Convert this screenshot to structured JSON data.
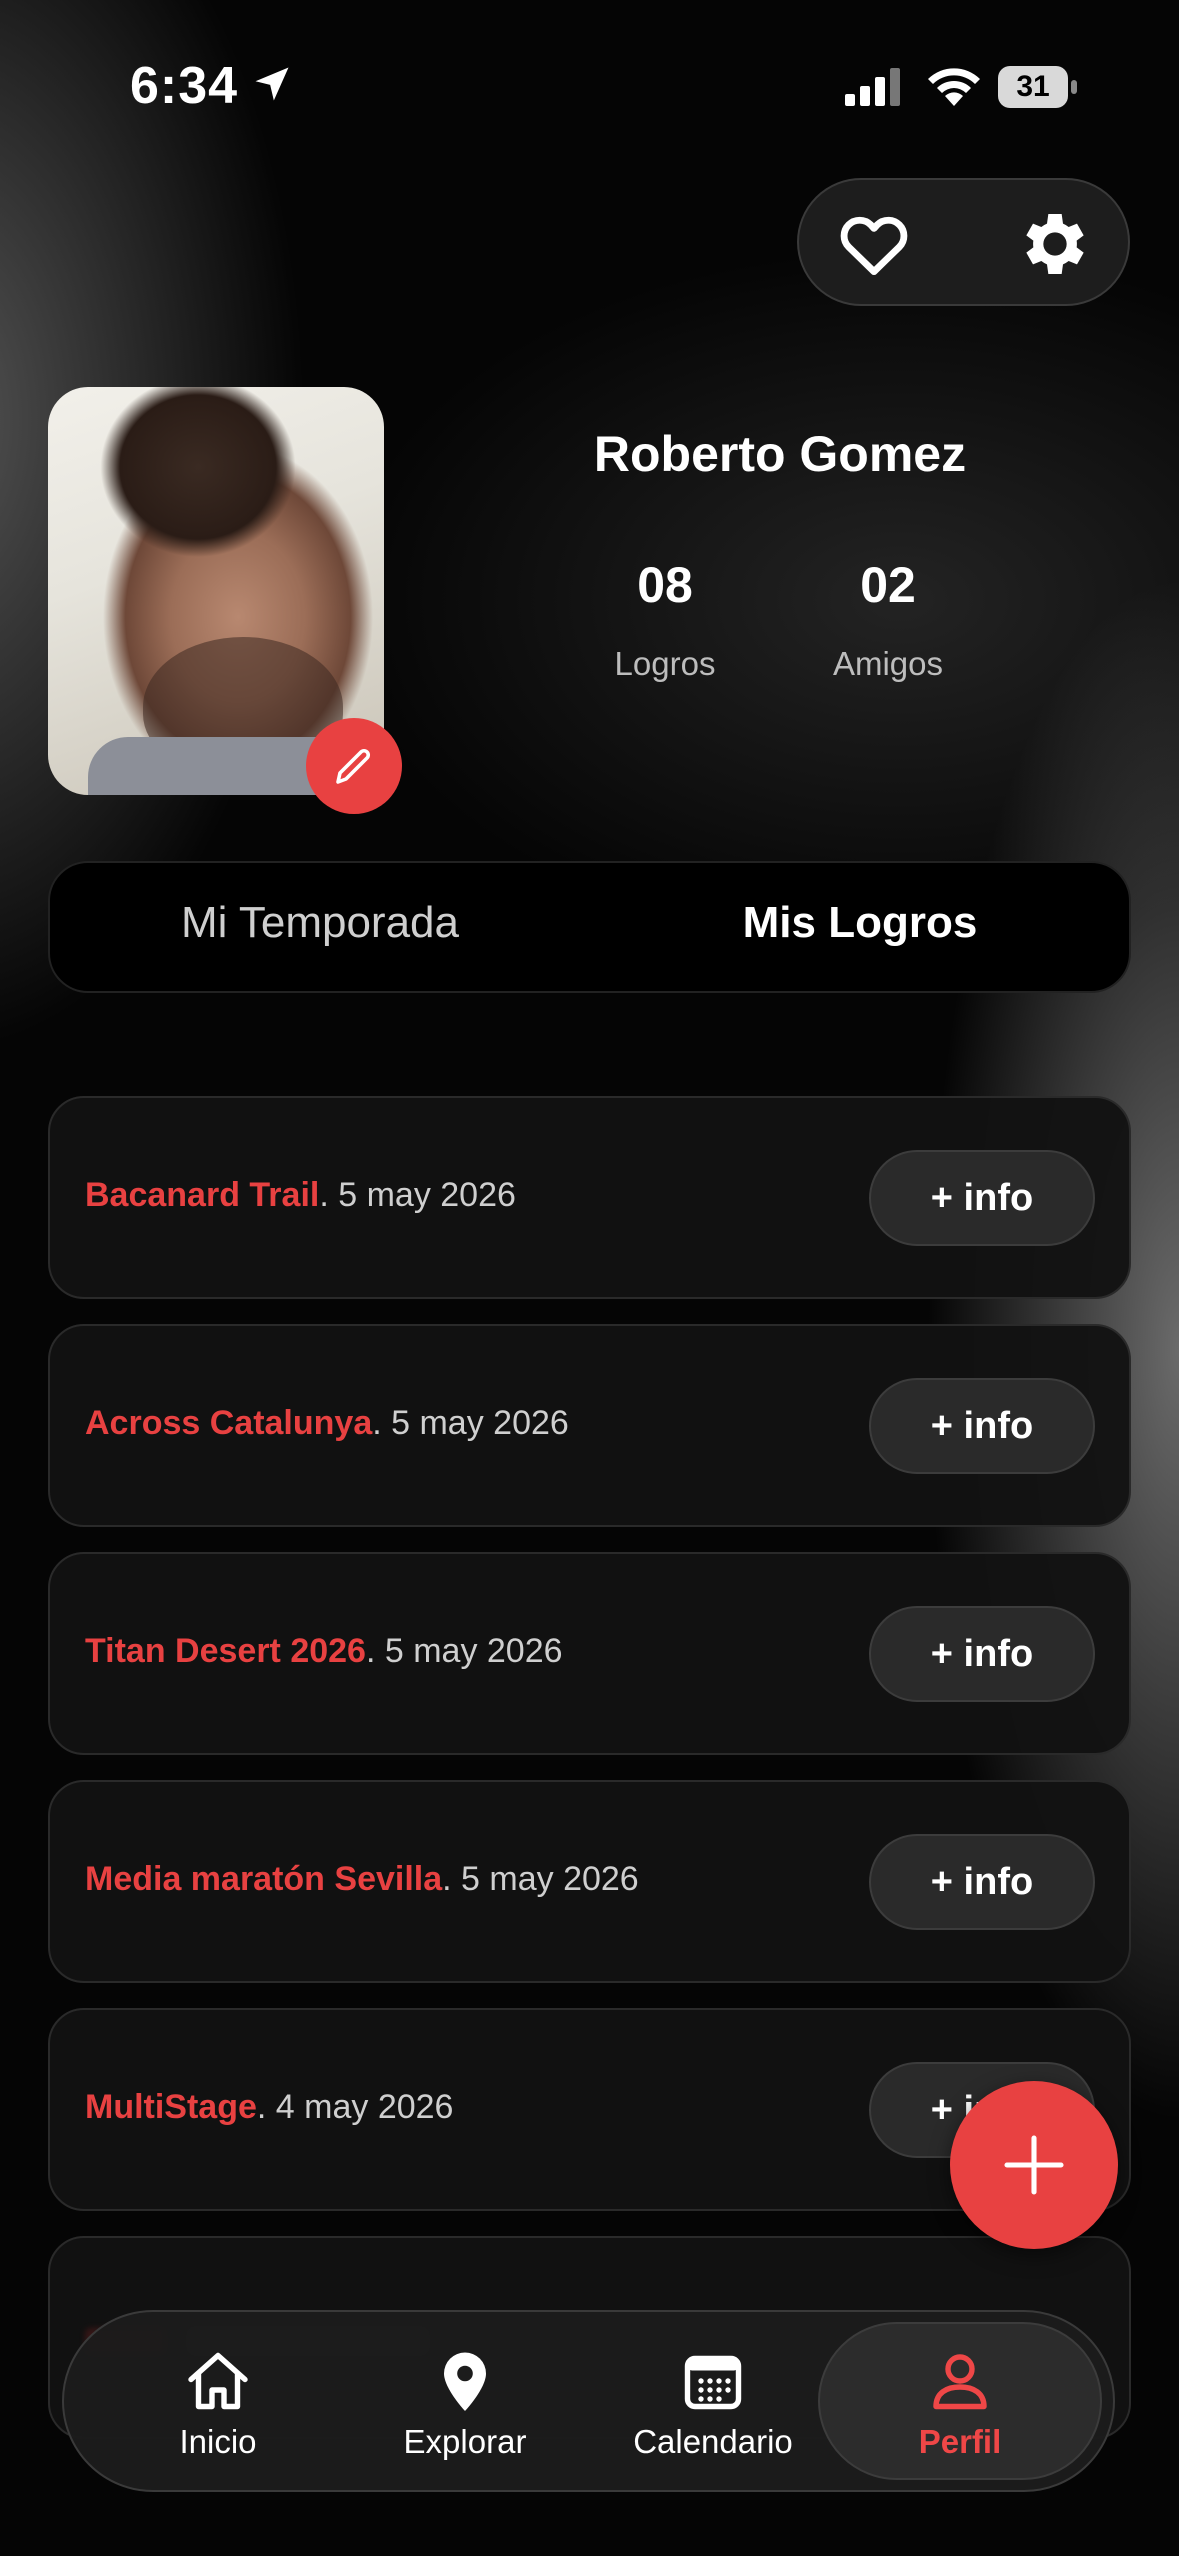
{
  "status_bar": {
    "time": "6:34",
    "battery": "31"
  },
  "profile": {
    "name": "Roberto Gomez",
    "stats": [
      {
        "value": "08",
        "label": "Logros"
      },
      {
        "value": "02",
        "label": "Amigos"
      }
    ]
  },
  "tabs": {
    "season": "Mi Temporada",
    "achievements": "Mis Logros",
    "selected": "Mis Logros"
  },
  "achievements": [
    {
      "name": "Bacanard Trail",
      "date": ". 5 may 2026",
      "button": "+ info"
    },
    {
      "name": "Across Catalunya",
      "date": ". 5 may 2026",
      "button": "+ info"
    },
    {
      "name": "Titan Desert 2026",
      "date": ". 5 may 2026",
      "button": "+ info"
    },
    {
      "name": "Media maratón Sevilla",
      "date": ". 5 may 2026",
      "button": "+ info"
    },
    {
      "name": "MultiStage",
      "date": ". 4 may 2026",
      "button": "+ info"
    }
  ],
  "bottom_nav": [
    {
      "label": "Inicio",
      "icon": "home-icon"
    },
    {
      "label": "Explorar",
      "icon": "map-pin-icon"
    },
    {
      "label": "Calendario",
      "icon": "calendar-icon"
    },
    {
      "label": "Perfil",
      "icon": "user-icon",
      "active": true
    }
  ],
  "colors": {
    "accent": "#e84141",
    "background": "#050505",
    "card": "#121212"
  }
}
